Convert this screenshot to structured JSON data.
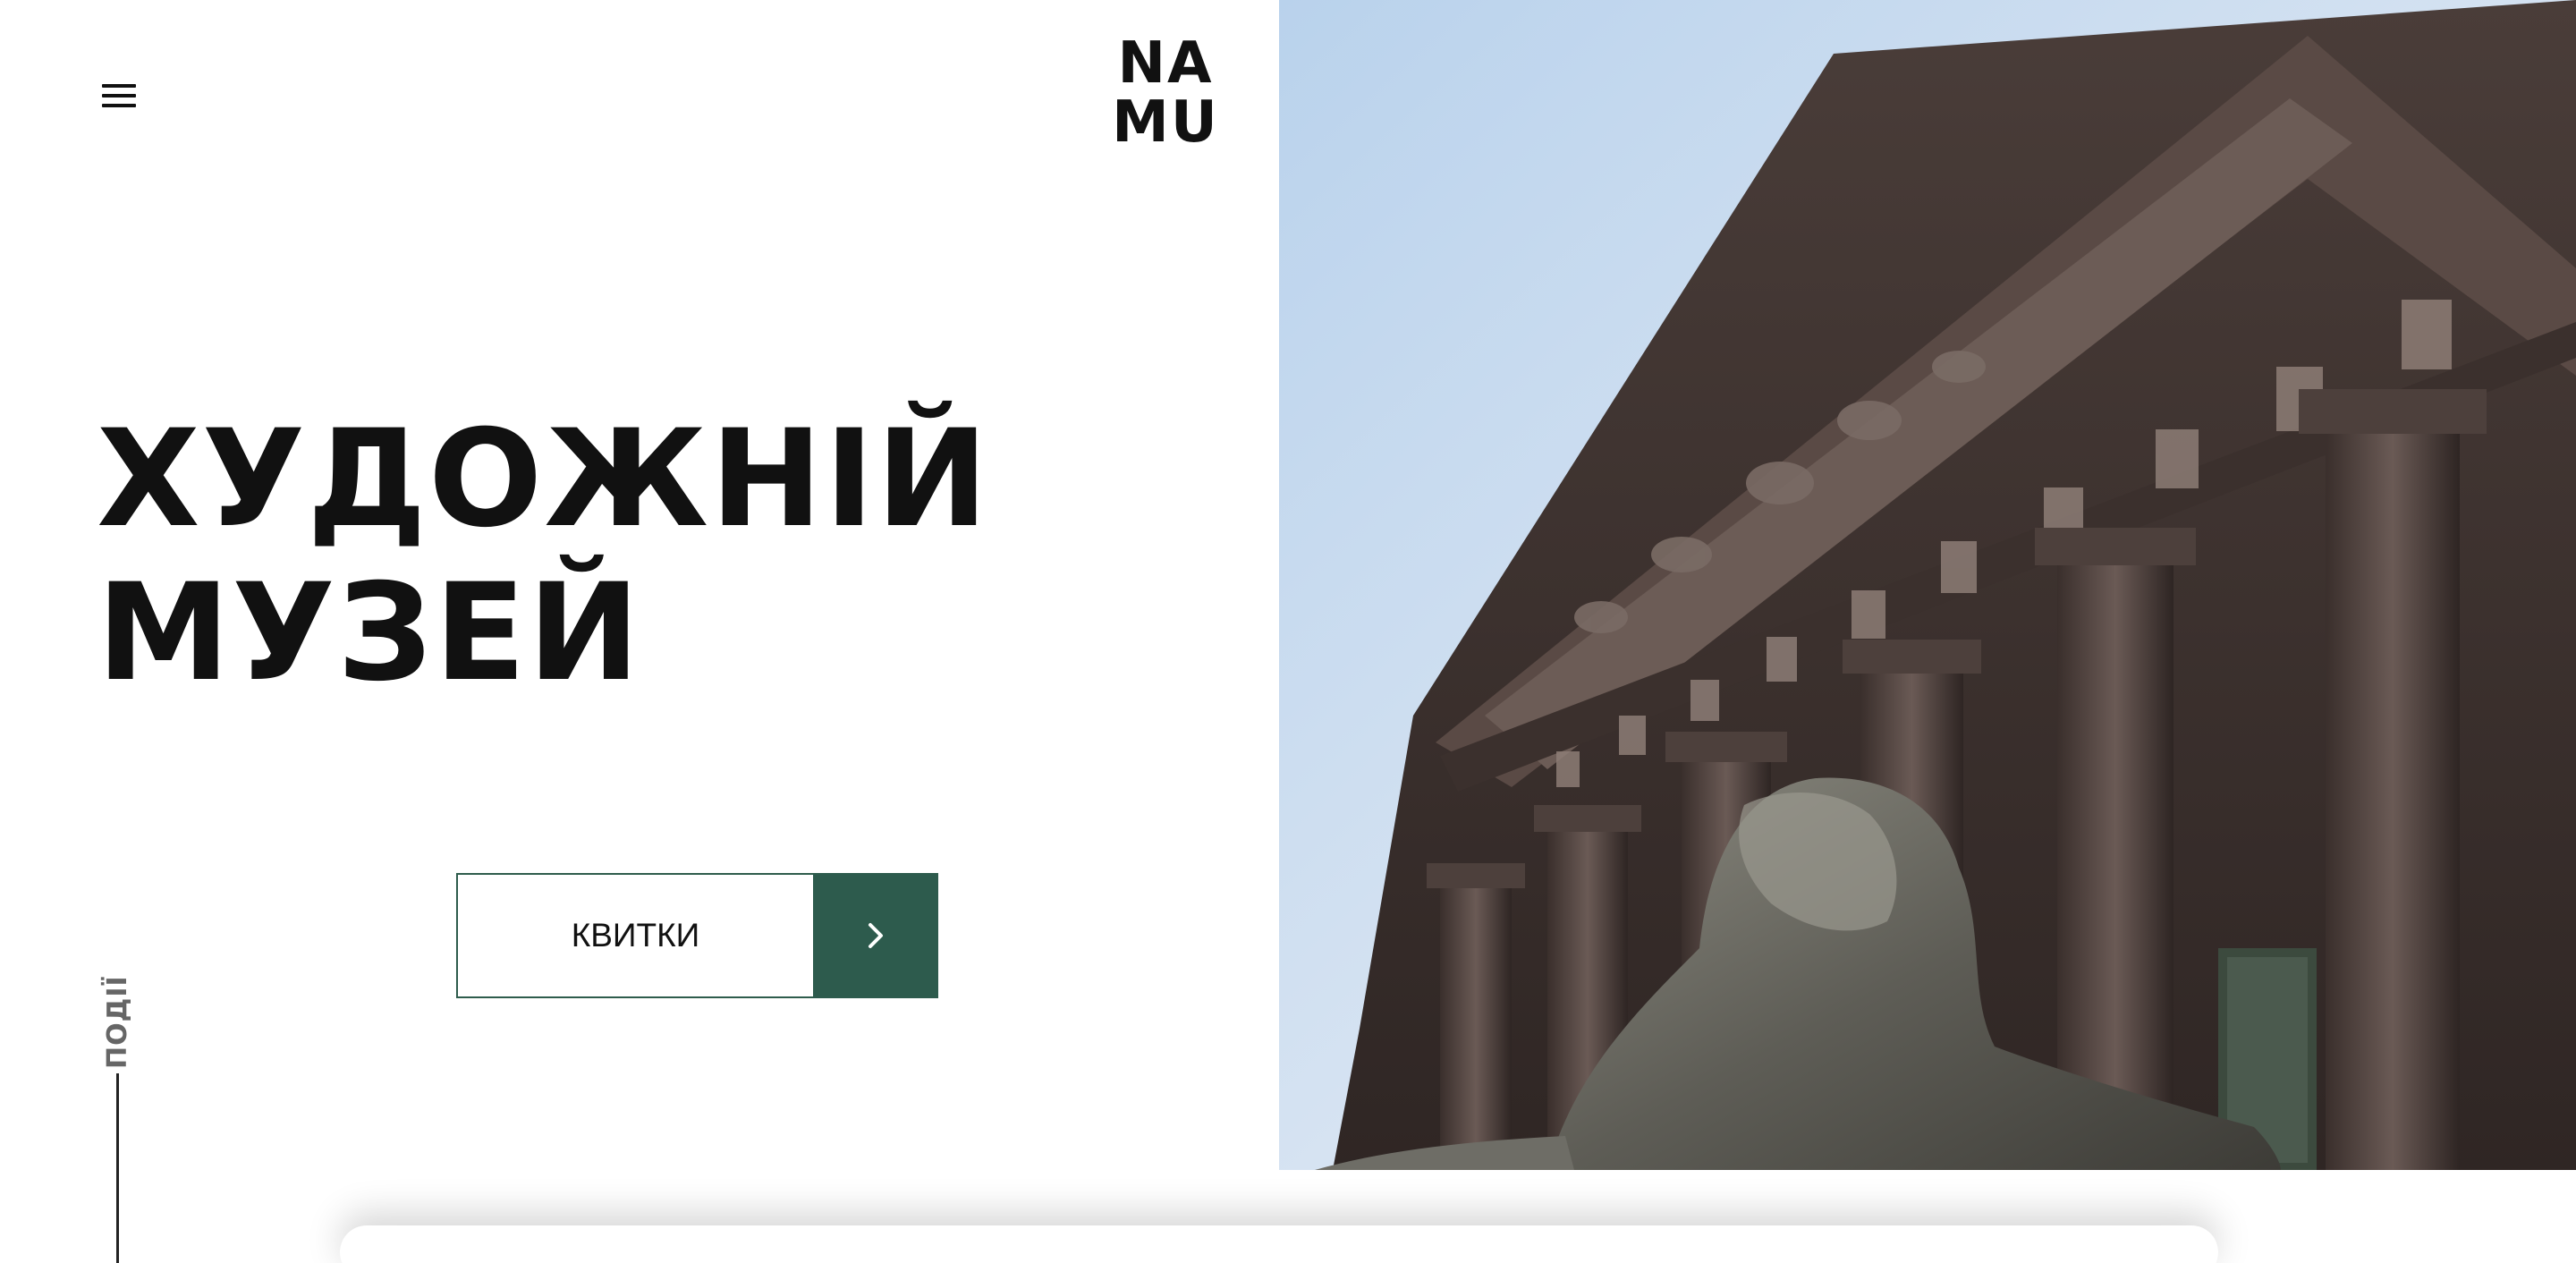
{
  "header": {
    "logo_line1": "NA",
    "logo_line2": "MU"
  },
  "hero": {
    "title_line1": "ХУДОЖНІЙ",
    "title_line2": "МУЗЕЙ",
    "tickets_label": "КВИТКИ"
  },
  "side": {
    "events_label": "ПОДІЇ"
  },
  "colors": {
    "accent_green": "#2d5b4d",
    "text": "#111111",
    "background": "#ffffff"
  },
  "icons": {
    "menu": "hamburger-menu-icon",
    "arrow": "chevron-right-icon"
  }
}
